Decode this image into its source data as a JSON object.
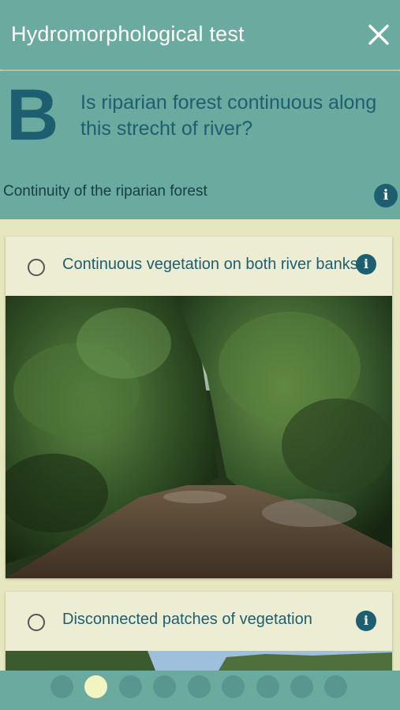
{
  "appbar": {
    "title": "Hydromorphological test",
    "close_icon": "close-icon"
  },
  "question": {
    "letter": "B",
    "text": "Is riparian forest continuous along this strecht of river?",
    "subtitle": "Continuity of the riparian forest",
    "info_icon": "info-icon"
  },
  "options": [
    {
      "label": "Continuous vegetation on both river banks",
      "selected": false
    },
    {
      "label": "Disconnected patches of vegetation",
      "selected": false
    }
  ],
  "pagination": {
    "count": 9,
    "active_index": 1
  },
  "colors": {
    "header": "#6aaa9f",
    "accent": "#1d5f70",
    "background": "#e6e6bf",
    "card": "#ededd4",
    "dot": "#5a9690",
    "dot_active": "#f2f4c2"
  }
}
